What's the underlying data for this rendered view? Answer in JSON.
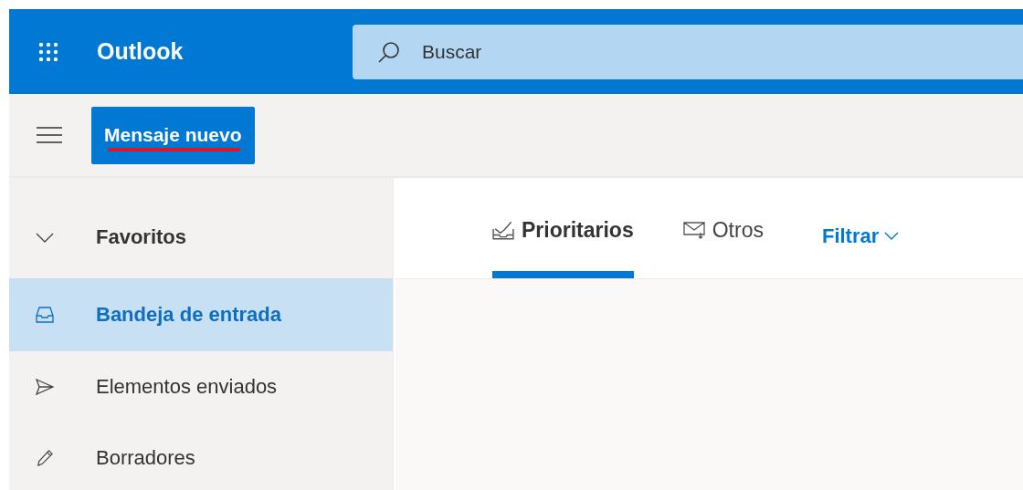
{
  "header": {
    "app_name": "Outlook",
    "search": {
      "placeholder": "Buscar"
    }
  },
  "command_bar": {
    "new_message_button": "Mensaje nuevo"
  },
  "sidebar": {
    "section": {
      "label": "Favoritos",
      "expanded": true
    },
    "items": [
      {
        "label": "Bandeja de entrada",
        "kind": "inbox",
        "selected": true
      },
      {
        "label": "Elementos enviados",
        "kind": "sent",
        "selected": false
      },
      {
        "label": "Borradores",
        "kind": "drafts",
        "selected": false
      }
    ]
  },
  "tabs": [
    {
      "label": "Prioritarios",
      "kind": "focused",
      "selected": true
    },
    {
      "label": "Otros",
      "kind": "other",
      "selected": false
    }
  ],
  "filter": {
    "label": "Filtrar"
  }
}
